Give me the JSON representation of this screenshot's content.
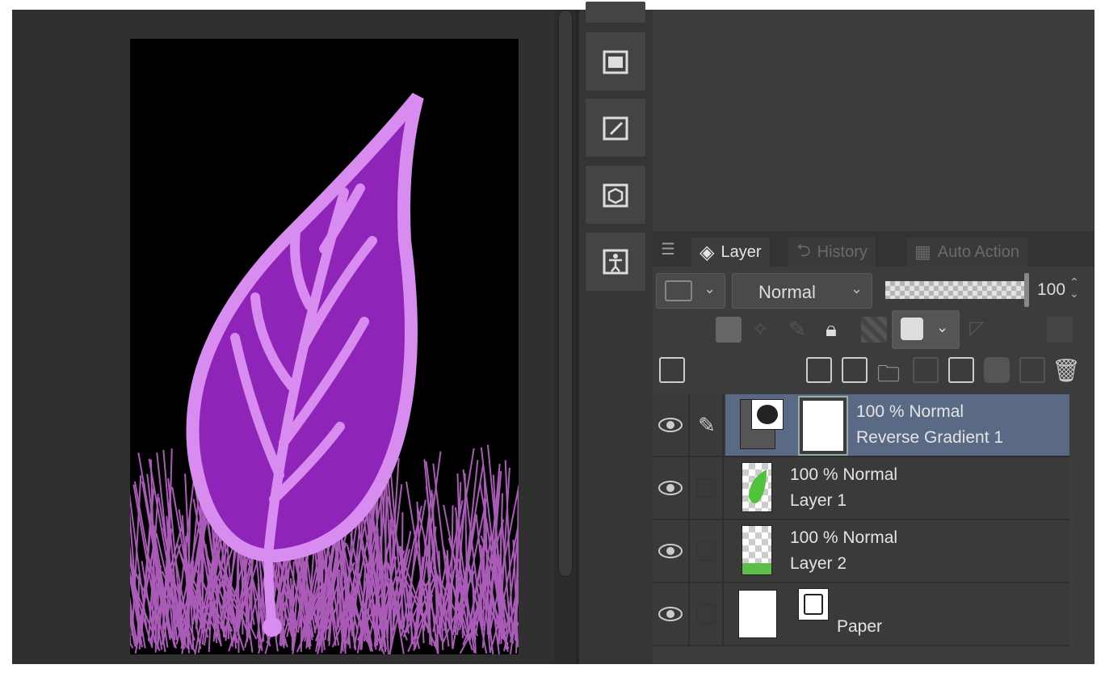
{
  "layer_panel": {
    "tabs": [
      {
        "label": "Layer",
        "icon": "layers-icon",
        "active": true
      },
      {
        "label": "History",
        "icon": "history-icon",
        "active": false
      },
      {
        "label": "Auto Action",
        "icon": "clapper-icon",
        "active": false
      }
    ],
    "blend_mode": "Normal",
    "opacity": "100",
    "opacity_fraction": 1.0,
    "layers": [
      {
        "line1": "100 % Normal",
        "name": "Reverse Gradient 1",
        "selected": true,
        "visible": true,
        "type": "gradient-map-correction"
      },
      {
        "line1": "100 % Normal",
        "name": "Layer 1",
        "selected": false,
        "visible": true,
        "type": "raster"
      },
      {
        "line1": "100 % Normal",
        "name": "Layer 2",
        "selected": false,
        "visible": true,
        "type": "raster"
      },
      {
        "line1": "",
        "name": "Paper",
        "selected": false,
        "visible": true,
        "type": "paper"
      }
    ]
  },
  "colors": {
    "leaf_fill": "#8e24b8",
    "leaf_outline": "#d98cf0",
    "grass": "#c86ad8",
    "selected_row": "#5a6a85"
  }
}
